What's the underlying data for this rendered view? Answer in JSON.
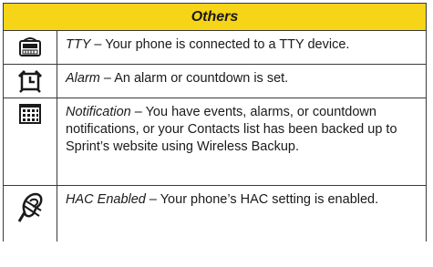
{
  "table": {
    "header": "Others",
    "rows": [
      {
        "icon": "tty-icon",
        "term": "TTY",
        "text": " – Your phone is connected to a TTY device."
      },
      {
        "icon": "alarm-icon",
        "term": "Alarm",
        "text": " – An alarm or countdown is set."
      },
      {
        "icon": "notification-icon",
        "term": "Notification",
        "text": " – You have events, alarms, or countdown notifications, or your Contacts list has been backed up to Sprint’s website using Wireless Backup."
      },
      {
        "icon": "hac-icon",
        "term": "HAC Enabled",
        "text": " – Your phone’s HAC setting is enabled."
      }
    ]
  },
  "colors": {
    "header_bg": "#f6d417",
    "border": "#3a3a3a"
  }
}
